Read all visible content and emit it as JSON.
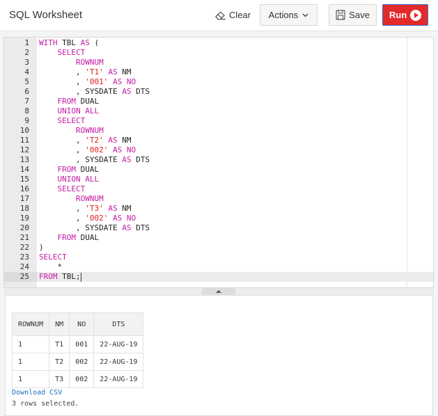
{
  "header": {
    "title": "SQL Worksheet",
    "clear": "Clear",
    "actions": "Actions",
    "save": "Save",
    "run": "Run"
  },
  "editor": {
    "lines": [
      [
        [
          "WITH",
          "kw"
        ],
        [
          " TBL ",
          ""
        ],
        [
          "AS",
          "kw"
        ],
        [
          " (",
          ""
        ]
      ],
      [
        [
          "    ",
          ""
        ],
        [
          "SELECT",
          "kw"
        ]
      ],
      [
        [
          "        ",
          ""
        ],
        [
          "ROWNUM",
          "kw"
        ]
      ],
      [
        [
          "        , ",
          ""
        ],
        [
          "'T1'",
          "str"
        ],
        [
          " ",
          ""
        ],
        [
          "AS",
          "kw"
        ],
        [
          " NM",
          ""
        ]
      ],
      [
        [
          "        , ",
          ""
        ],
        [
          "'001'",
          "str"
        ],
        [
          " ",
          ""
        ],
        [
          "AS",
          "kw"
        ],
        [
          " ",
          ""
        ],
        [
          "NO",
          "kw"
        ]
      ],
      [
        [
          "        , SYSDATE ",
          ""
        ],
        [
          "AS",
          "kw"
        ],
        [
          " DTS",
          ""
        ]
      ],
      [
        [
          "    ",
          ""
        ],
        [
          "FROM",
          "kw"
        ],
        [
          " DUAL",
          ""
        ]
      ],
      [
        [
          "    ",
          ""
        ],
        [
          "UNION ALL",
          "kw"
        ]
      ],
      [
        [
          "    ",
          ""
        ],
        [
          "SELECT",
          "kw"
        ]
      ],
      [
        [
          "        ",
          ""
        ],
        [
          "ROWNUM",
          "kw"
        ]
      ],
      [
        [
          "        , ",
          ""
        ],
        [
          "'T2'",
          "str"
        ],
        [
          " ",
          ""
        ],
        [
          "AS",
          "kw"
        ],
        [
          " NM",
          ""
        ]
      ],
      [
        [
          "        , ",
          ""
        ],
        [
          "'002'",
          "str"
        ],
        [
          " ",
          ""
        ],
        [
          "AS",
          "kw"
        ],
        [
          " ",
          ""
        ],
        [
          "NO",
          "kw"
        ]
      ],
      [
        [
          "        , SYSDATE ",
          ""
        ],
        [
          "AS",
          "kw"
        ],
        [
          " DTS",
          ""
        ]
      ],
      [
        [
          "    ",
          ""
        ],
        [
          "FROM",
          "kw"
        ],
        [
          " DUAL",
          ""
        ]
      ],
      [
        [
          "    ",
          ""
        ],
        [
          "UNION ALL",
          "kw"
        ]
      ],
      [
        [
          "    ",
          ""
        ],
        [
          "SELECT",
          "kw"
        ]
      ],
      [
        [
          "        ",
          ""
        ],
        [
          "ROWNUM",
          "kw"
        ]
      ],
      [
        [
          "        , ",
          ""
        ],
        [
          "'T3'",
          "str"
        ],
        [
          " ",
          ""
        ],
        [
          "AS",
          "kw"
        ],
        [
          " NM",
          ""
        ]
      ],
      [
        [
          "        , ",
          ""
        ],
        [
          "'002'",
          "str"
        ],
        [
          " ",
          ""
        ],
        [
          "AS",
          "kw"
        ],
        [
          " ",
          ""
        ],
        [
          "NO",
          "kw"
        ]
      ],
      [
        [
          "        , SYSDATE ",
          ""
        ],
        [
          "AS",
          "kw"
        ],
        [
          " DTS",
          ""
        ]
      ],
      [
        [
          "    ",
          ""
        ],
        [
          "FROM",
          "kw"
        ],
        [
          " DUAL",
          ""
        ]
      ],
      [
        [
          ")",
          ""
        ]
      ],
      [
        [
          "SELECT",
          "kw"
        ]
      ],
      [
        [
          "    *",
          ""
        ]
      ],
      [
        [
          "FROM",
          "kw"
        ],
        [
          " TBL;",
          ""
        ]
      ]
    ],
    "active_line": 25
  },
  "results": {
    "columns": [
      "ROWNUM",
      "NM",
      "NO",
      "DTS"
    ],
    "rows": [
      [
        "1",
        "T1",
        "001",
        "22-AUG-19"
      ],
      [
        "1",
        "T2",
        "002",
        "22-AUG-19"
      ],
      [
        "1",
        "T3",
        "002",
        "22-AUG-19"
      ]
    ],
    "download": "Download CSV",
    "status": "3 rows selected."
  }
}
